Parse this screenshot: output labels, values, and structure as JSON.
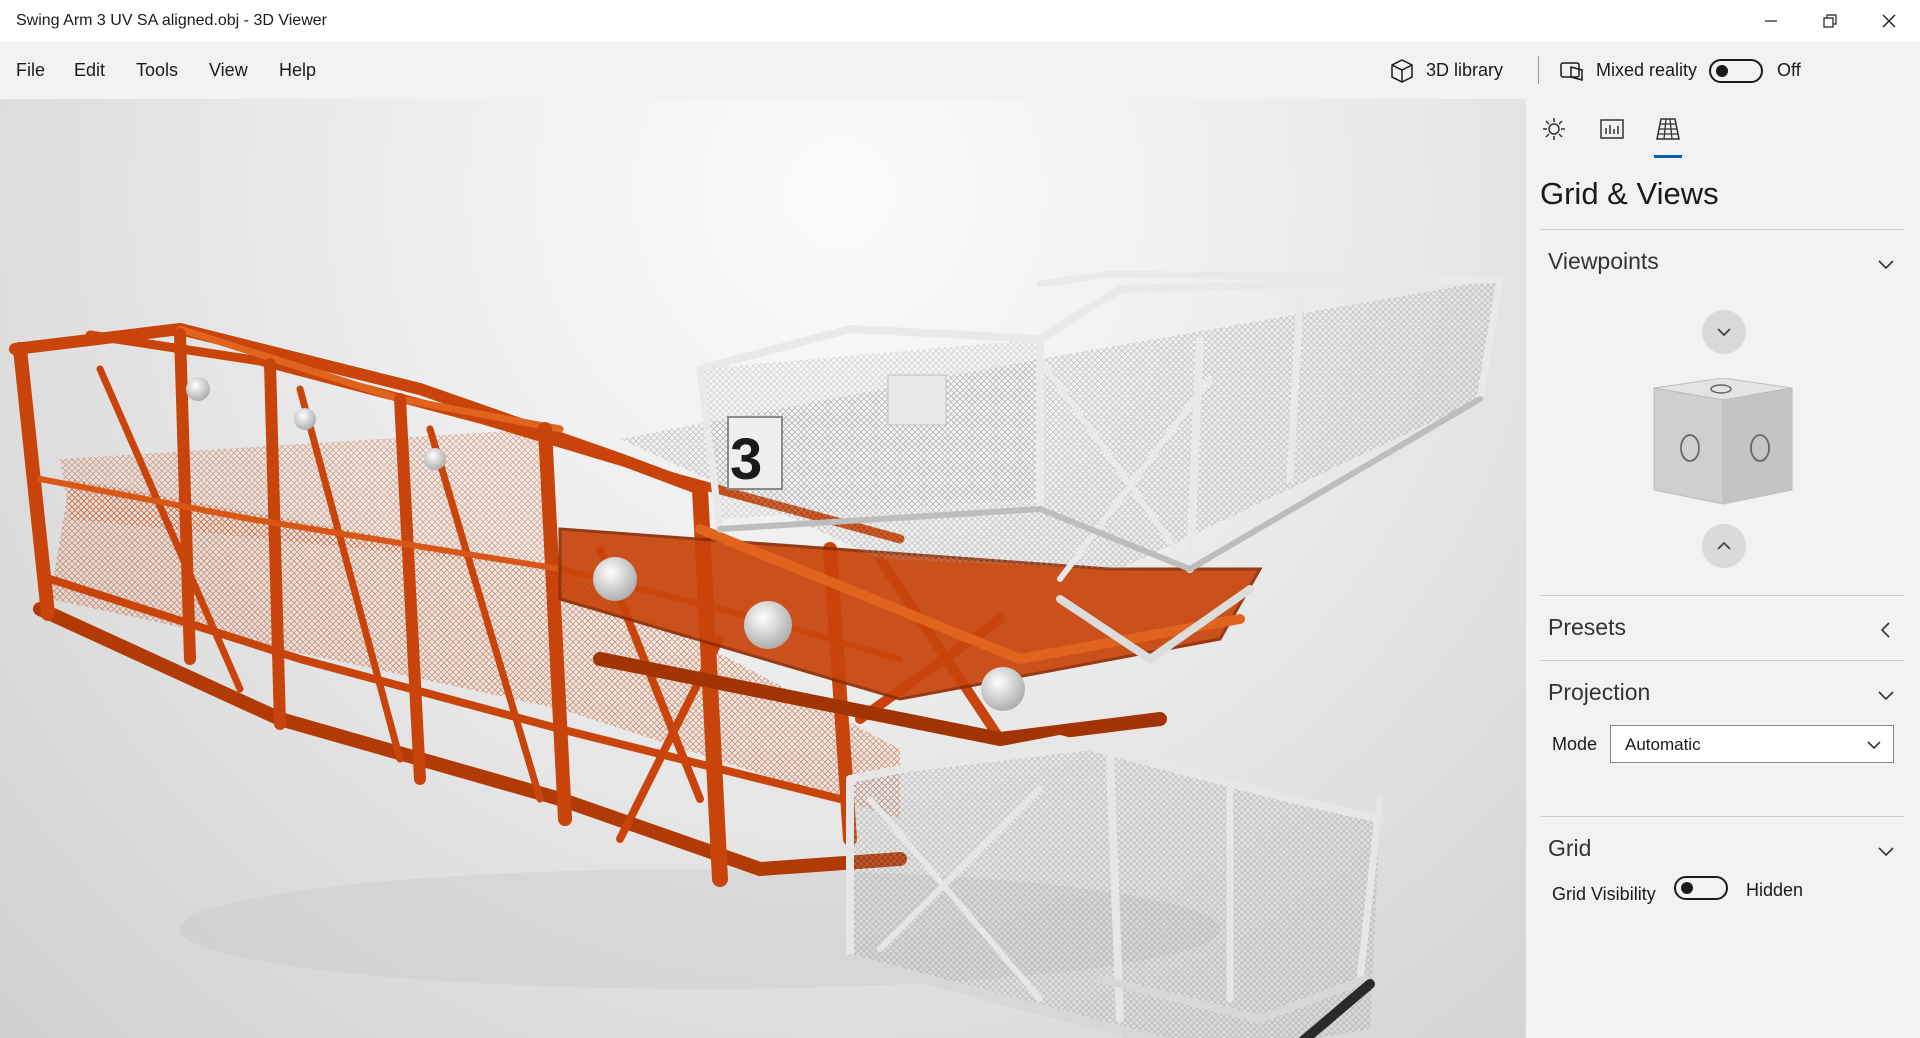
{
  "window": {
    "title": "Swing Arm 3 UV SA aligned.obj - 3D Viewer",
    "controls": [
      "minimize-icon",
      "restore-icon",
      "close-icon"
    ]
  },
  "menu": {
    "items": [
      "File",
      "Edit",
      "Tools",
      "View",
      "Help"
    ],
    "library_label": "3D library",
    "mixed_reality_label": "Mixed reality",
    "mixed_reality_state": "Off"
  },
  "model": {
    "platform_number": "3",
    "colors": {
      "frame": "#c8440a",
      "frame_dark": "#8e2c04",
      "frame_light": "#e0641e",
      "rails": "#e9e9e9",
      "rails_shadow": "#a9a9a9"
    }
  },
  "panel": {
    "tabs": [
      "lighting-icon",
      "stats-icon",
      "grid-icon"
    ],
    "active_tab": "grid-icon",
    "title": "Grid & Views",
    "sections": {
      "viewpoints": {
        "label": "Viewpoints",
        "expanded": true
      },
      "presets": {
        "label": "Presets",
        "expanded": false
      },
      "projection": {
        "label": "Projection",
        "expanded": true,
        "mode_label": "Mode",
        "mode_value": "Automatic"
      },
      "grid": {
        "label": "Grid",
        "expanded": true,
        "visibility_label": "Grid Visibility",
        "visibility_state": "Hidden"
      }
    },
    "accent": "#0063b1"
  }
}
